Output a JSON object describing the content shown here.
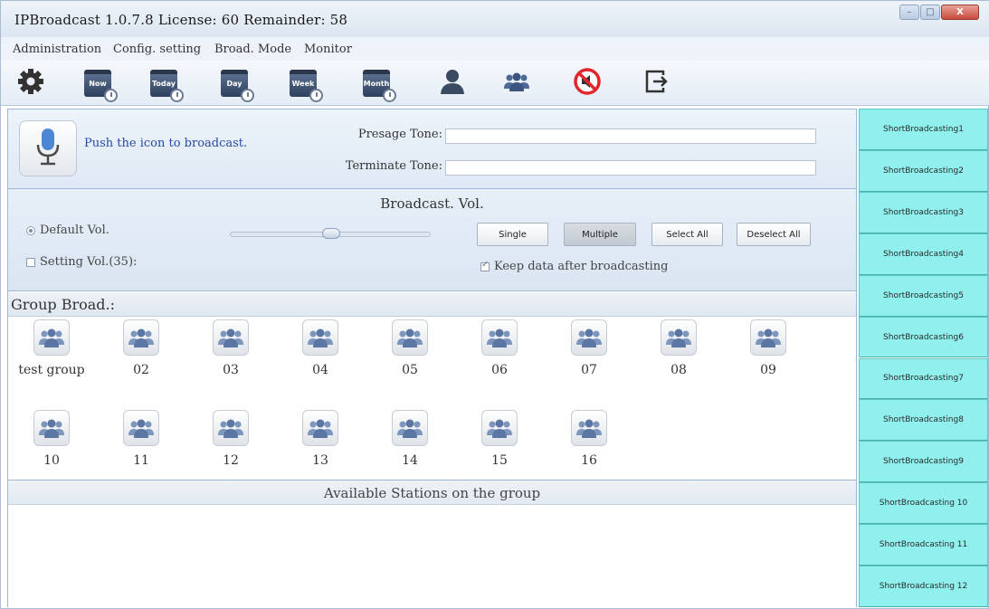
{
  "window": {
    "title": "IPBroadcast 1.0.7.8 License: 60 Remainder: 58",
    "controls": {
      "minimize": "–",
      "maximize": "□",
      "close": "X"
    }
  },
  "menu": {
    "items": [
      {
        "label": "Administration"
      },
      {
        "label": "Config. setting"
      },
      {
        "label": "Broad. Mode"
      },
      {
        "label": "Monitor"
      }
    ]
  },
  "toolbar": {
    "items": [
      {
        "icon": "gear-icon"
      },
      {
        "icon": "calendar-clock-icon",
        "text": "Now"
      },
      {
        "icon": "calendar-clock-icon",
        "text": "Today"
      },
      {
        "icon": "calendar-clock-icon",
        "text": "Day"
      },
      {
        "icon": "calendar-clock-icon",
        "text": "Week"
      },
      {
        "icon": "calendar-clock-icon",
        "text": "Month"
      },
      {
        "icon": "user-icon"
      },
      {
        "icon": "group-icon"
      },
      {
        "icon": "mute-icon"
      },
      {
        "icon": "exit-icon"
      }
    ]
  },
  "broadcast": {
    "hint": "Push the icon to broadcast.",
    "presage_label": "Presage Tone:",
    "presage_value": "",
    "terminate_label": "Terminate Tone:",
    "terminate_value": ""
  },
  "volume": {
    "title": "Broadcast. Vol.",
    "default_label": "Default Vol.",
    "setting_label": "Setting Vol.(35):",
    "slider_fraction": 0.5,
    "buttons": {
      "single": "Single",
      "multiple": "Multiple",
      "select_all": "Select All",
      "deselect_all": "Deselect All"
    },
    "keep_data_label": "Keep data after broadcasting"
  },
  "groups": {
    "title": "Group Broad.:",
    "items": [
      {
        "label": "test group"
      },
      {
        "label": "02"
      },
      {
        "label": "03"
      },
      {
        "label": "04"
      },
      {
        "label": "05"
      },
      {
        "label": "06"
      },
      {
        "label": "07"
      },
      {
        "label": "08"
      },
      {
        "label": "09"
      },
      {
        "label": "10"
      },
      {
        "label": "11"
      },
      {
        "label": "12"
      },
      {
        "label": "13"
      },
      {
        "label": "14"
      },
      {
        "label": "15"
      },
      {
        "label": "16"
      }
    ]
  },
  "stations": {
    "title": "Available Stations on the group"
  },
  "short_broadcasts": [
    "ShortBroadcasting1",
    "ShortBroadcasting2",
    "ShortBroadcasting3",
    "ShortBroadcasting4",
    "ShortBroadcasting5",
    "ShortBroadcasting6",
    "ShortBroadcasting7",
    "ShortBroadcasting8",
    "ShortBroadcasting9",
    "ShortBroadcasting 10",
    "ShortBroadcasting 11",
    "ShortBroadcasting 12"
  ],
  "colors": {
    "accent_cyan": "#8ff0ee",
    "hint_blue": "#2649a8",
    "mute_red": "#e0262c"
  }
}
